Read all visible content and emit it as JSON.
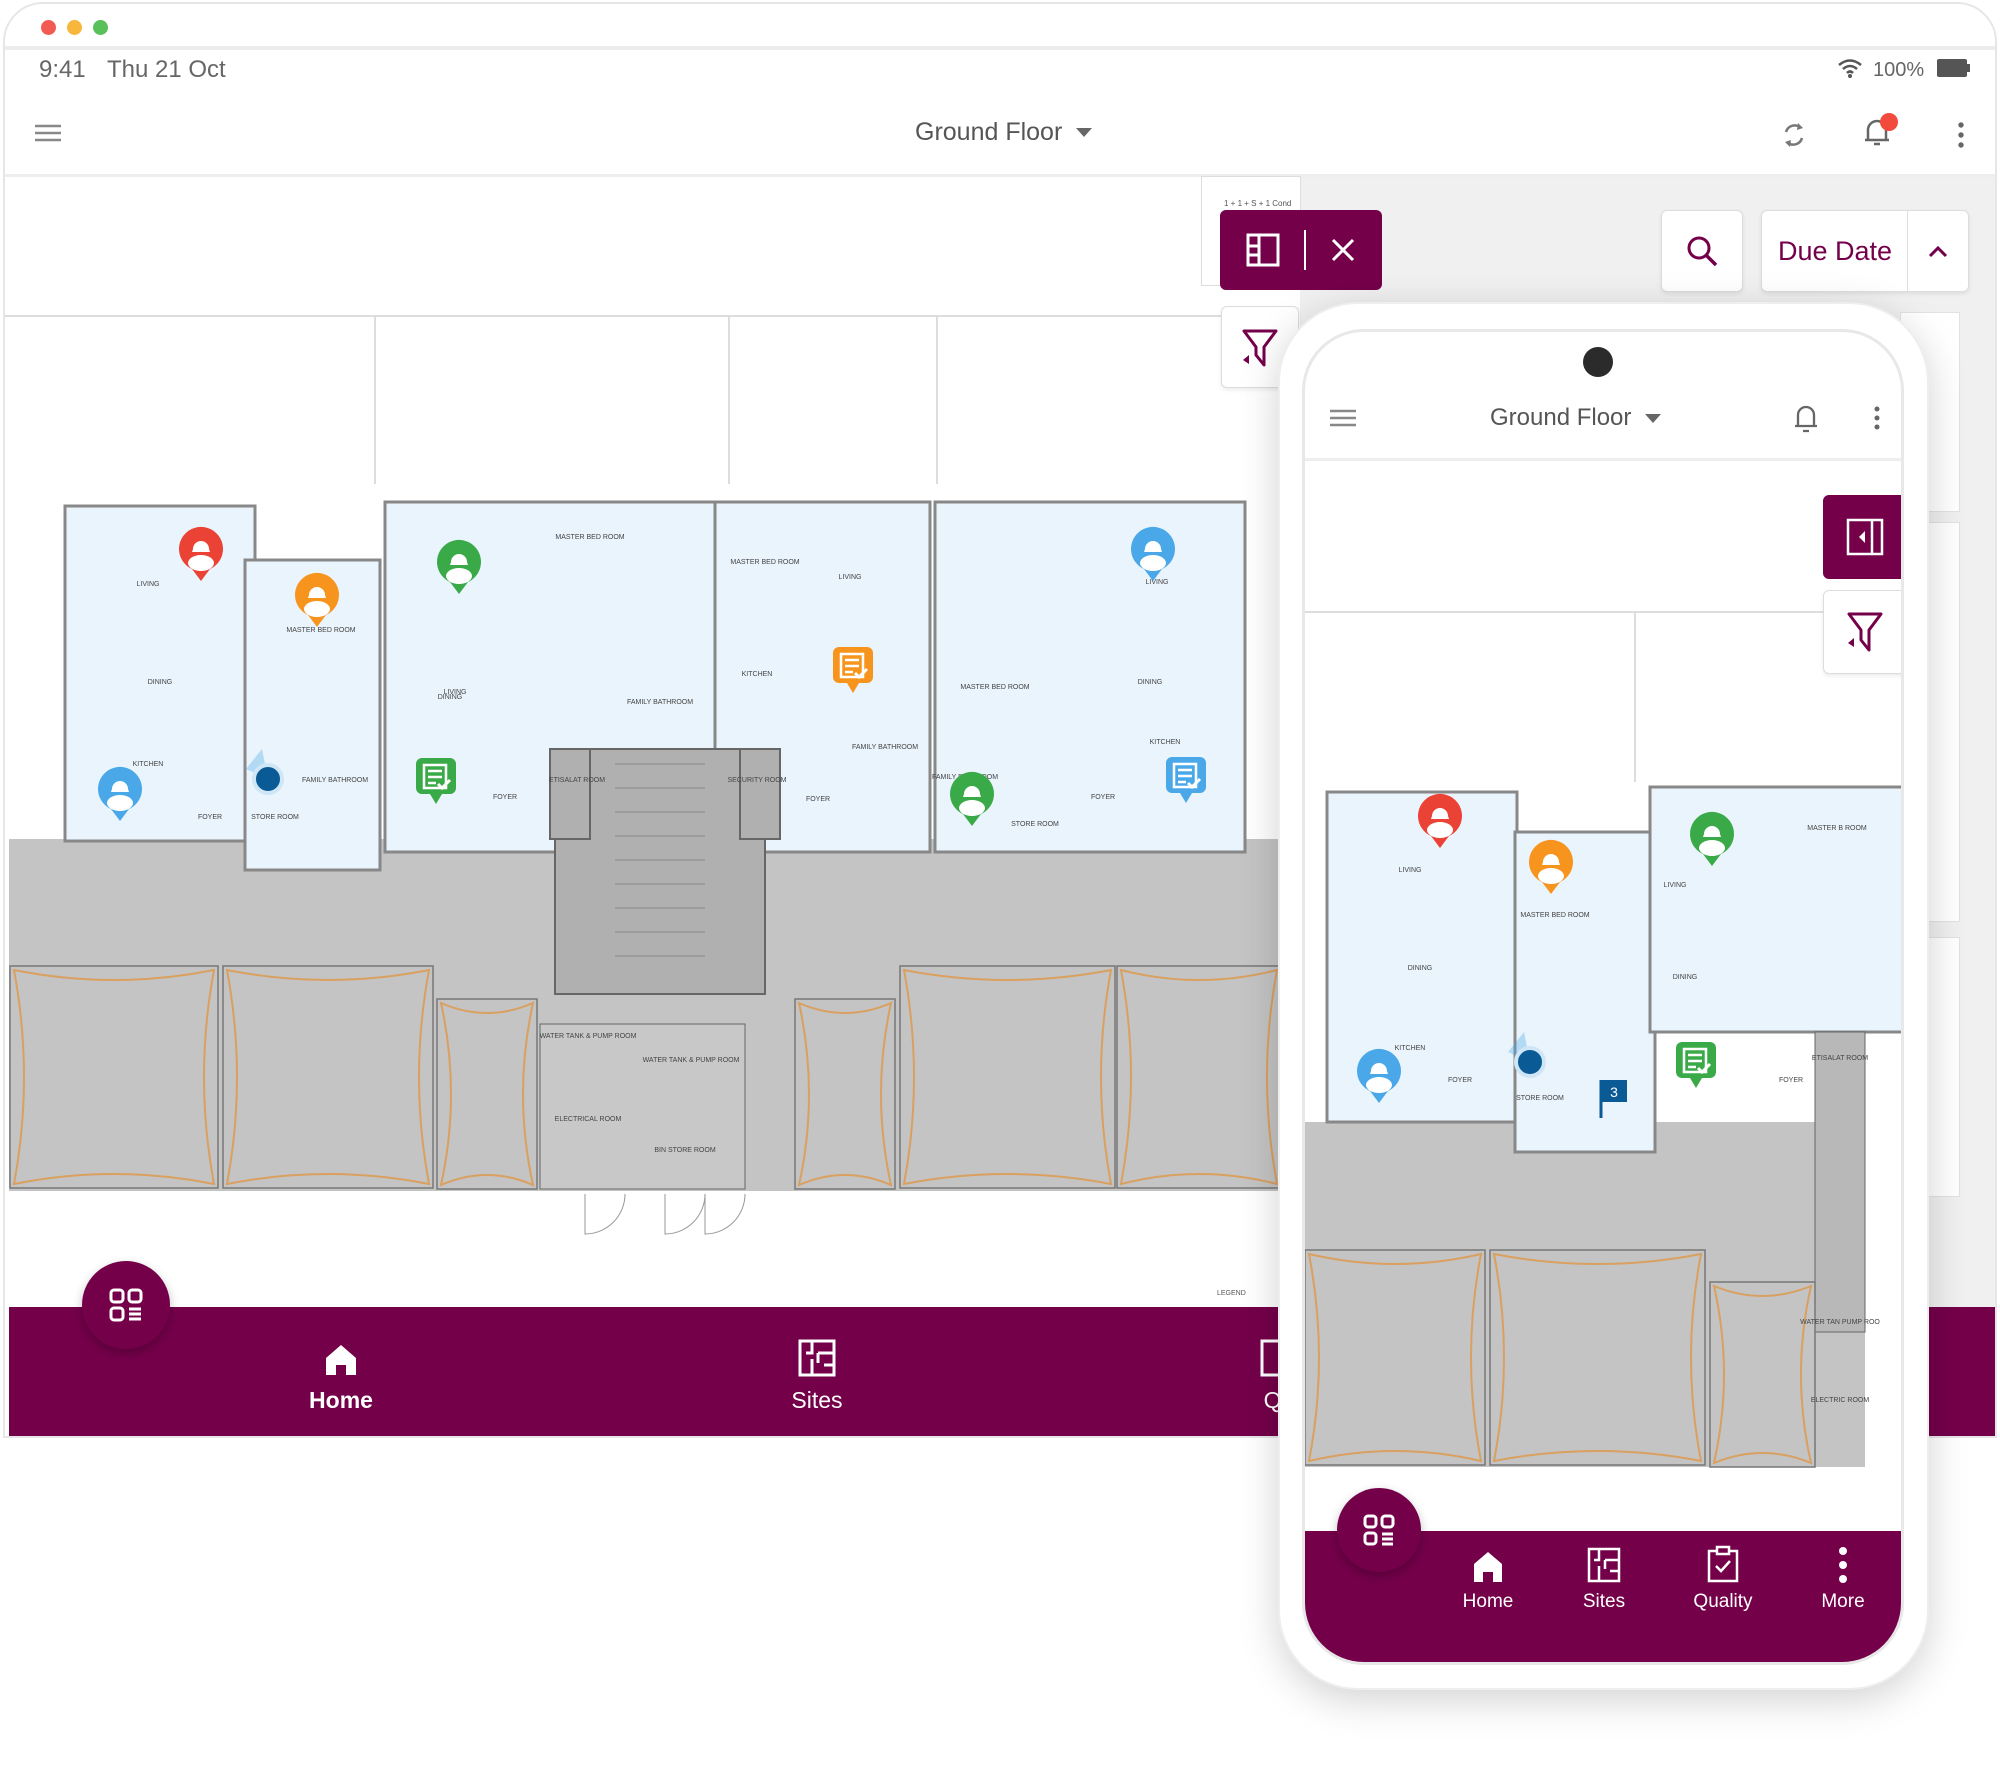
{
  "colors": {
    "brand": "#74004a",
    "room_fill": "#eaf4fc",
    "hall_fill": "#c4c4c4",
    "marker_red": "#ea4335",
    "marker_orange": "#f7941d",
    "marker_green": "#3aaa48",
    "marker_blue": "#4aa8e8",
    "location_dot": "#0a5a96"
  },
  "status_bar": {
    "time": "9:41",
    "date": "Thu 21 Oct",
    "battery": "100%",
    "icons": [
      "wifi-icon",
      "battery-icon"
    ]
  },
  "tablet": {
    "header": {
      "title": "Ground Floor",
      "icons": [
        "menu-icon",
        "sync-icon",
        "bell-icon",
        "more-vertical-icon"
      ]
    },
    "toolbar": {
      "panel_icon": "panel-toggle-icon",
      "close_icon": "close-icon",
      "filter_icon": "filter-icon",
      "search_icon": "search-icon",
      "sort_label": "Due Date",
      "sort_icon": "chevron-up-icon"
    },
    "plan_label": "1 + 1 + S + 1 Cond",
    "legend": "LEGEND",
    "rooms": [
      "LIVING",
      "DINING",
      "KITCHEN",
      "MASTER BED ROOM",
      "FAMILY BATHROOM",
      "FOYER",
      "STORE ROOM",
      "LIVING",
      "DINING",
      "MASTER BED ROOM",
      "FAMILY BATHROOM",
      "FOYER",
      "ETISALAT ROOM",
      "SECURITY ROOM",
      "MASTER BED ROOM",
      "LIVING",
      "KITCHEN",
      "FAMILY BATHROOM",
      "FOYER",
      "MASTER BED ROOM",
      "FAMILY BATHROOM",
      "STORE ROOM",
      "LIVING",
      "DINING",
      "KITCHEN",
      "FOYER",
      "WATER TANK & PUMP ROOM",
      "WATER TANK & PUMP ROOM",
      "ELECTRICAL ROOM",
      "BIN STORE ROOM"
    ],
    "nav": [
      {
        "label": "Home",
        "icon": "home-icon"
      },
      {
        "label": "Sites",
        "icon": "floorplan-icon"
      },
      {
        "label": "Qu",
        "icon": "quality-icon"
      }
    ],
    "fab_icon": "qr-grid-icon"
  },
  "phone": {
    "header": {
      "title": "Ground Floor",
      "icons": [
        "menu-icon",
        "bell-icon",
        "more-vertical-icon"
      ]
    },
    "side_buttons": [
      "panel-collapse-icon",
      "filter-icon"
    ],
    "rooms": [
      "LIVING",
      "DINING",
      "KITCHEN",
      "MASTER BED ROOM",
      "FOYER",
      "STORE ROOM",
      "LIVING",
      "DINING",
      "MASTER B ROOM",
      "FOYER",
      "ETISALAT ROOM",
      "WATER TAN PUMP ROO",
      "ELECTRIC ROOM"
    ],
    "flag_badge": "3",
    "nav": [
      {
        "label": "Home",
        "icon": "home-icon"
      },
      {
        "label": "Sites",
        "icon": "floorplan-icon"
      },
      {
        "label": "Quality",
        "icon": "clipboard-check-icon"
      },
      {
        "label": "More",
        "icon": "more-vertical-icon"
      }
    ],
    "fab_icon": "qr-grid-icon"
  },
  "markers": {
    "tablet": [
      {
        "type": "worker",
        "color": "red"
      },
      {
        "type": "worker",
        "color": "orange"
      },
      {
        "type": "worker",
        "color": "green"
      },
      {
        "type": "worker",
        "color": "blue"
      },
      {
        "type": "worker",
        "color": "blue"
      },
      {
        "type": "document",
        "color": "green"
      },
      {
        "type": "document",
        "color": "orange"
      },
      {
        "type": "worker",
        "color": "green"
      },
      {
        "type": "document",
        "color": "blue"
      }
    ],
    "phone": [
      {
        "type": "worker",
        "color": "red"
      },
      {
        "type": "worker",
        "color": "orange"
      },
      {
        "type": "worker",
        "color": "green"
      },
      {
        "type": "worker",
        "color": "blue"
      },
      {
        "type": "document",
        "color": "green"
      }
    ]
  }
}
